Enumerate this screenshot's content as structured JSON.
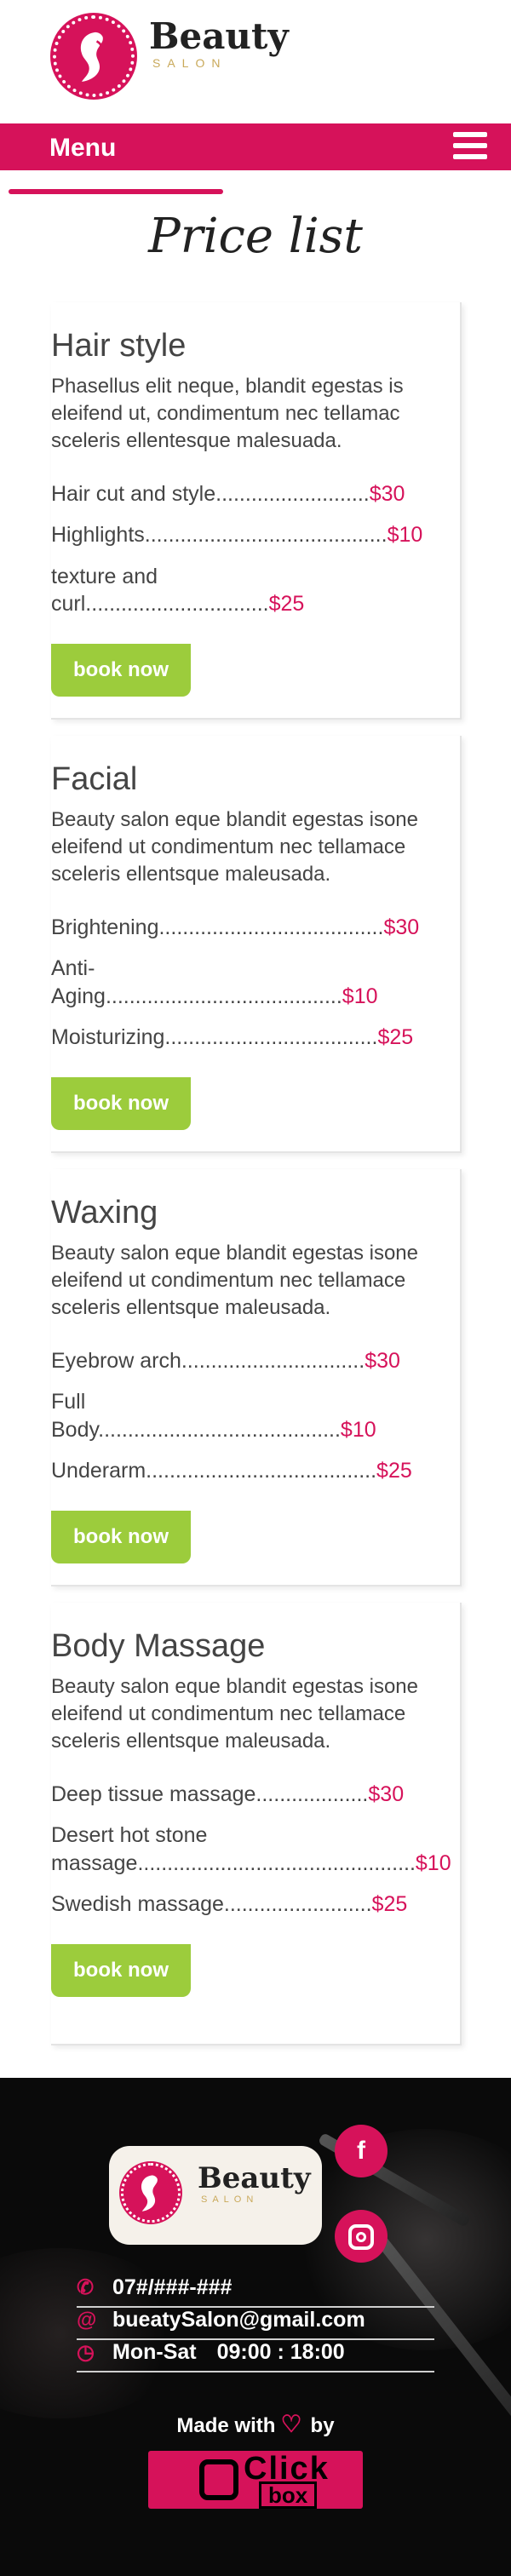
{
  "header": {
    "brand_name": "Beauty",
    "brand_sub": "SALON"
  },
  "nav": {
    "menu_label": "Menu"
  },
  "page": {
    "title": "Price list"
  },
  "button_label": "book now",
  "sections": [
    {
      "title": "Hair style",
      "description": "Phasellus elit neque, blandit egestas is eleifend ut, condimentum nec tellamac sceleris ellentesque malesuada.",
      "items": [
        {
          "name": "Hair cut and style",
          "dots": "..........................",
          "price": "$30"
        },
        {
          "name": "Highlights",
          "dots": ".........................................",
          "price": "$10"
        },
        {
          "name": "texture and curl",
          "dots": "...............................",
          "price": "$25"
        }
      ]
    },
    {
      "title": "Facial",
      "description": "Beauty salon eque blandit egestas isone eleifend ut condimentum nec tellamace sceleris ellentsque maleusada.",
      "items": [
        {
          "name": "Brightening",
          "dots": "......................................",
          "price": "$30"
        },
        {
          "name": "Anti- Aging",
          "dots": "........................................",
          "price": "$10"
        },
        {
          "name": "Moisturizing",
          "dots": "....................................",
          "price": "$25"
        }
      ]
    },
    {
      "title": "Waxing",
      "description": "Beauty salon eque blandit egestas isone eleifend ut condimentum nec tellamace sceleris ellentsque maleusada.",
      "items": [
        {
          "name": "Eyebrow arch",
          "dots": "...............................",
          "price": "$30"
        },
        {
          "name": "Full Body",
          "dots": ".........................................",
          "price": "$10"
        },
        {
          "name": "Underarm",
          "dots": ".......................................",
          "price": "$25"
        }
      ]
    },
    {
      "title": "Body Massage",
      "description": "Beauty salon eque blandit egestas isone eleifend ut condimentum nec tellamace sceleris ellentsque maleusada.",
      "items": [
        {
          "name": "Deep tissue massage",
          "dots": "...................",
          "price": "$30"
        },
        {
          "name": "Desert hot stone massage",
          "dots": "...............................................",
          "price": "$10"
        },
        {
          "name": "Swedish massage",
          "dots": ".........................",
          "price": "$25"
        }
      ]
    }
  ],
  "footer": {
    "brand_name": "Beauty",
    "brand_sub": "SALON",
    "phone": "07#/###-###",
    "email": "bueatySalon@gmail.com",
    "days": "Mon-Sat",
    "hours": "09:00 : 18:00",
    "made_with": "Made with",
    "by": "by",
    "credit_line1": "Click",
    "credit_line2": "box"
  },
  "icons": {
    "facebook": "facebook-icon",
    "instagram": "instagram-icon",
    "phone": "phone-icon",
    "email": "at-sign-icon",
    "clock": "clock-icon",
    "heart": "heart-icon",
    "menu": "hamburger-icon"
  },
  "colors": {
    "accent": "#d6125a",
    "button": "#9ccc3c",
    "footer_bg": "#0a0a0a",
    "gold": "#c9a95a"
  }
}
